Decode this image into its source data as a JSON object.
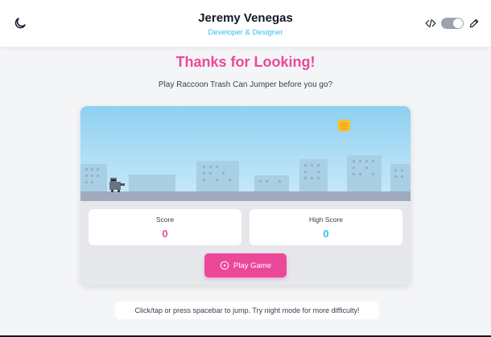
{
  "header": {
    "name": "Jeremy Venegas",
    "role": "Developer & Designer",
    "theme_icon": "moon-icon",
    "code_icon": "code-icon",
    "edit_icon": "pencil-icon",
    "toggle_on": true
  },
  "main": {
    "title": "Thanks for Looking!",
    "subtitle": "Play Raccoon Trash Can Jumper before you go?"
  },
  "game": {
    "score_label": "Score",
    "score_value": "0",
    "high_score_label": "High Score",
    "high_score_value": "0",
    "play_label": "Play Game",
    "play_icon": "play-circle-icon"
  },
  "hint": "Click/tap or press spacebar to jump. Try night mode for more difficulty!",
  "colors": {
    "accent_pink": "#ec4899",
    "accent_blue": "#38bdf8",
    "sky": "#93d4f3",
    "buildings": "#a9cfe4",
    "ground": "#9ca3af"
  }
}
